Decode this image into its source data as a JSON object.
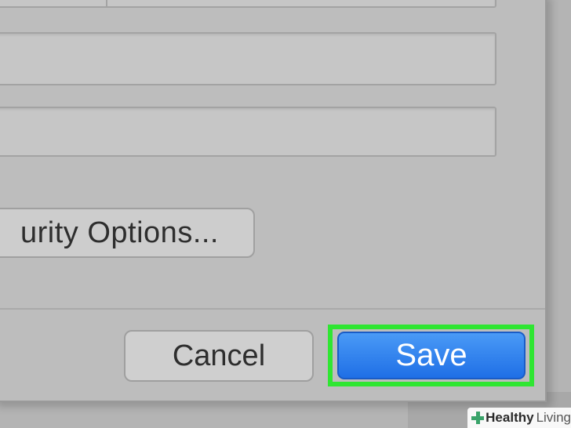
{
  "dialog": {
    "security_options_label": "urity Options...",
    "cancel_label": "Cancel",
    "save_label": "Save"
  },
  "watermark": {
    "brand_bold": "Healthy",
    "brand_light": "Living",
    "icon": "plus-cross-icon",
    "icon_color": "#3aa36a"
  },
  "colors": {
    "accent_save": "#2a7df0",
    "highlight": "#2fe632"
  }
}
